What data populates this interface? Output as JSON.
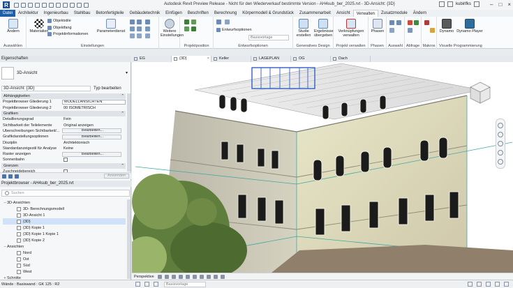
{
  "window": {
    "title": "Autodesk Revit Preview Release - Nicht für den Wiederverkauf bestimmte Version - AH4sub_ber_2025.rvt - 3D-Ansicht: {3D}",
    "user": "kubirlfks",
    "logo_letter": "R"
  },
  "ribbon_tabs": [
    "Datei",
    "Architektur",
    "Ingenieurbau",
    "Stahlbau",
    "Betonfertigteile",
    "Gebäudetechnik",
    "Einfügen",
    "Beschriften",
    "Berechnung",
    "Körpermodell & Grundstück",
    "Zusammenarbeit",
    "Ansicht",
    "Verwalten",
    "Zusatzmodule",
    "Ändern"
  ],
  "ribbon": {
    "aendern": "Ändern",
    "auswaehlen": "Auswählen",
    "materialien": "Materialien",
    "objektstile": "Objektstile",
    "objektfang": "Objektfang",
    "projektinformationen": "Projektinformationen",
    "parameterdienst": "Parameterdienst",
    "weitere": "Weitere",
    "einstellungen": "Einstellungen",
    "einstellungen_group": "Einstellungen",
    "projektposition": "Projektposition",
    "entwurfsoptionen": "Entwurfsoptionen",
    "basisvorlage": "Basisvorlage",
    "entwurfsoptionen_group": "Entwurfsoptionen",
    "studie_1": "Studie",
    "studie_2": "erstellen",
    "ergebnisse_1": "Ergebnisse",
    "ergebnisse_2": "übergeben",
    "generatives_design": "Generatives Design",
    "verknuepfungen_1": "Verknüpfungen",
    "verknuepfungen_2": "verwalten",
    "projekt_verwalten": "Projekt verwalten",
    "phasen": "Phasen",
    "phasen_group": "Phasen",
    "auswahl": "Auswahl",
    "abfrage": "Abfrage",
    "makros": "Makros",
    "dynamo": "Dynamo",
    "dynamo_player": "Dynamo Player",
    "visuelle_programmierung": "Visuelle Programmierung"
  },
  "properties": {
    "header": "Eigenschaften",
    "type_name": "3D-Ansicht",
    "instance": "3D-Ansicht: {3D}",
    "edit_type": "Typ bearbeiten",
    "rows": [
      {
        "kind": "section",
        "label": "Abhängigkeiten"
      },
      {
        "kind": "box",
        "label": "Projektbrowser Gliederung 1",
        "value": "MODELLANSICHTEN"
      },
      {
        "kind": "text",
        "label": "Projektbrowser Gliederung 2",
        "value": "00 ISOMETRISCH"
      },
      {
        "kind": "section",
        "label": "Grafiken"
      },
      {
        "kind": "text",
        "label": "Detaillierungsgrad",
        "value": "Fein"
      },
      {
        "kind": "text",
        "label": "Sichtbarkeit der Teilelemente",
        "value": "Original anzeigen"
      },
      {
        "kind": "button",
        "label": "Überschreibungen Sichtbarkeit/...",
        "value": "Bearbeiten..."
      },
      {
        "kind": "button",
        "label": "Grafikdarstellungsoptionen",
        "value": "Bearbeiten..."
      },
      {
        "kind": "text",
        "label": "Disziplin",
        "value": "Architektonisch"
      },
      {
        "kind": "text",
        "label": "Standardanzeigestil für Analyse",
        "value": "Keine"
      },
      {
        "kind": "button",
        "label": "Raster anzeigen",
        "value": "Bearbeiten..."
      },
      {
        "kind": "check",
        "label": "Sonnenbahn",
        "value": ""
      },
      {
        "kind": "section",
        "label": "Grenzen"
      },
      {
        "kind": "check",
        "label": "Zuschneidebereich",
        "value": ""
      }
    ],
    "apply": "Anwenden"
  },
  "browser": {
    "header": "Projektbrowser - AH4sub_ber_2025.rvt",
    "search_placeholder": "Suchen",
    "items": [
      {
        "level": 1,
        "toggle": "−",
        "icon": false,
        "label": "3D-Ansichten"
      },
      {
        "level": 2,
        "toggle": "",
        "icon": true,
        "label": "3D- Berechnungsmodell"
      },
      {
        "level": 2,
        "toggle": "",
        "icon": true,
        "label": "3D-Ansicht 1"
      },
      {
        "level": 2,
        "toggle": "",
        "icon": true,
        "label": "{3D}",
        "selected": true
      },
      {
        "level": 2,
        "toggle": "",
        "icon": true,
        "label": "{3D} Kopie 1"
      },
      {
        "level": 2,
        "toggle": "",
        "icon": true,
        "label": "{3D} Kopie 1 Kopie 1"
      },
      {
        "level": 2,
        "toggle": "",
        "icon": true,
        "label": "{3D} Kopie 2"
      },
      {
        "level": 1,
        "toggle": "−",
        "icon": false,
        "label": "Ansichten"
      },
      {
        "level": 2,
        "toggle": "",
        "icon": true,
        "label": "Nord"
      },
      {
        "level": 2,
        "toggle": "",
        "icon": true,
        "label": "Ost"
      },
      {
        "level": 2,
        "toggle": "",
        "icon": true,
        "label": "Süd"
      },
      {
        "level": 2,
        "toggle": "",
        "icon": true,
        "label": "West"
      },
      {
        "level": 1,
        "toggle": "+",
        "icon": false,
        "label": "Schnitte"
      }
    ]
  },
  "view_tabs": [
    "EG",
    "{3D}",
    "Keller",
    "LAGEPLAN",
    "OG",
    "Dach"
  ],
  "view_bar": {
    "projection": "Perspektive"
  },
  "status": {
    "text": "Wände : Basiswand : GK 125 : R2",
    "model": "Basisvorlage"
  },
  "colors": {
    "accent": "#1f5ea8",
    "file_tab": "#1f5ea8",
    "selection": "#cfe2f7",
    "section_box": "#3fa9a0",
    "window_frames": "#2f5fc4"
  }
}
